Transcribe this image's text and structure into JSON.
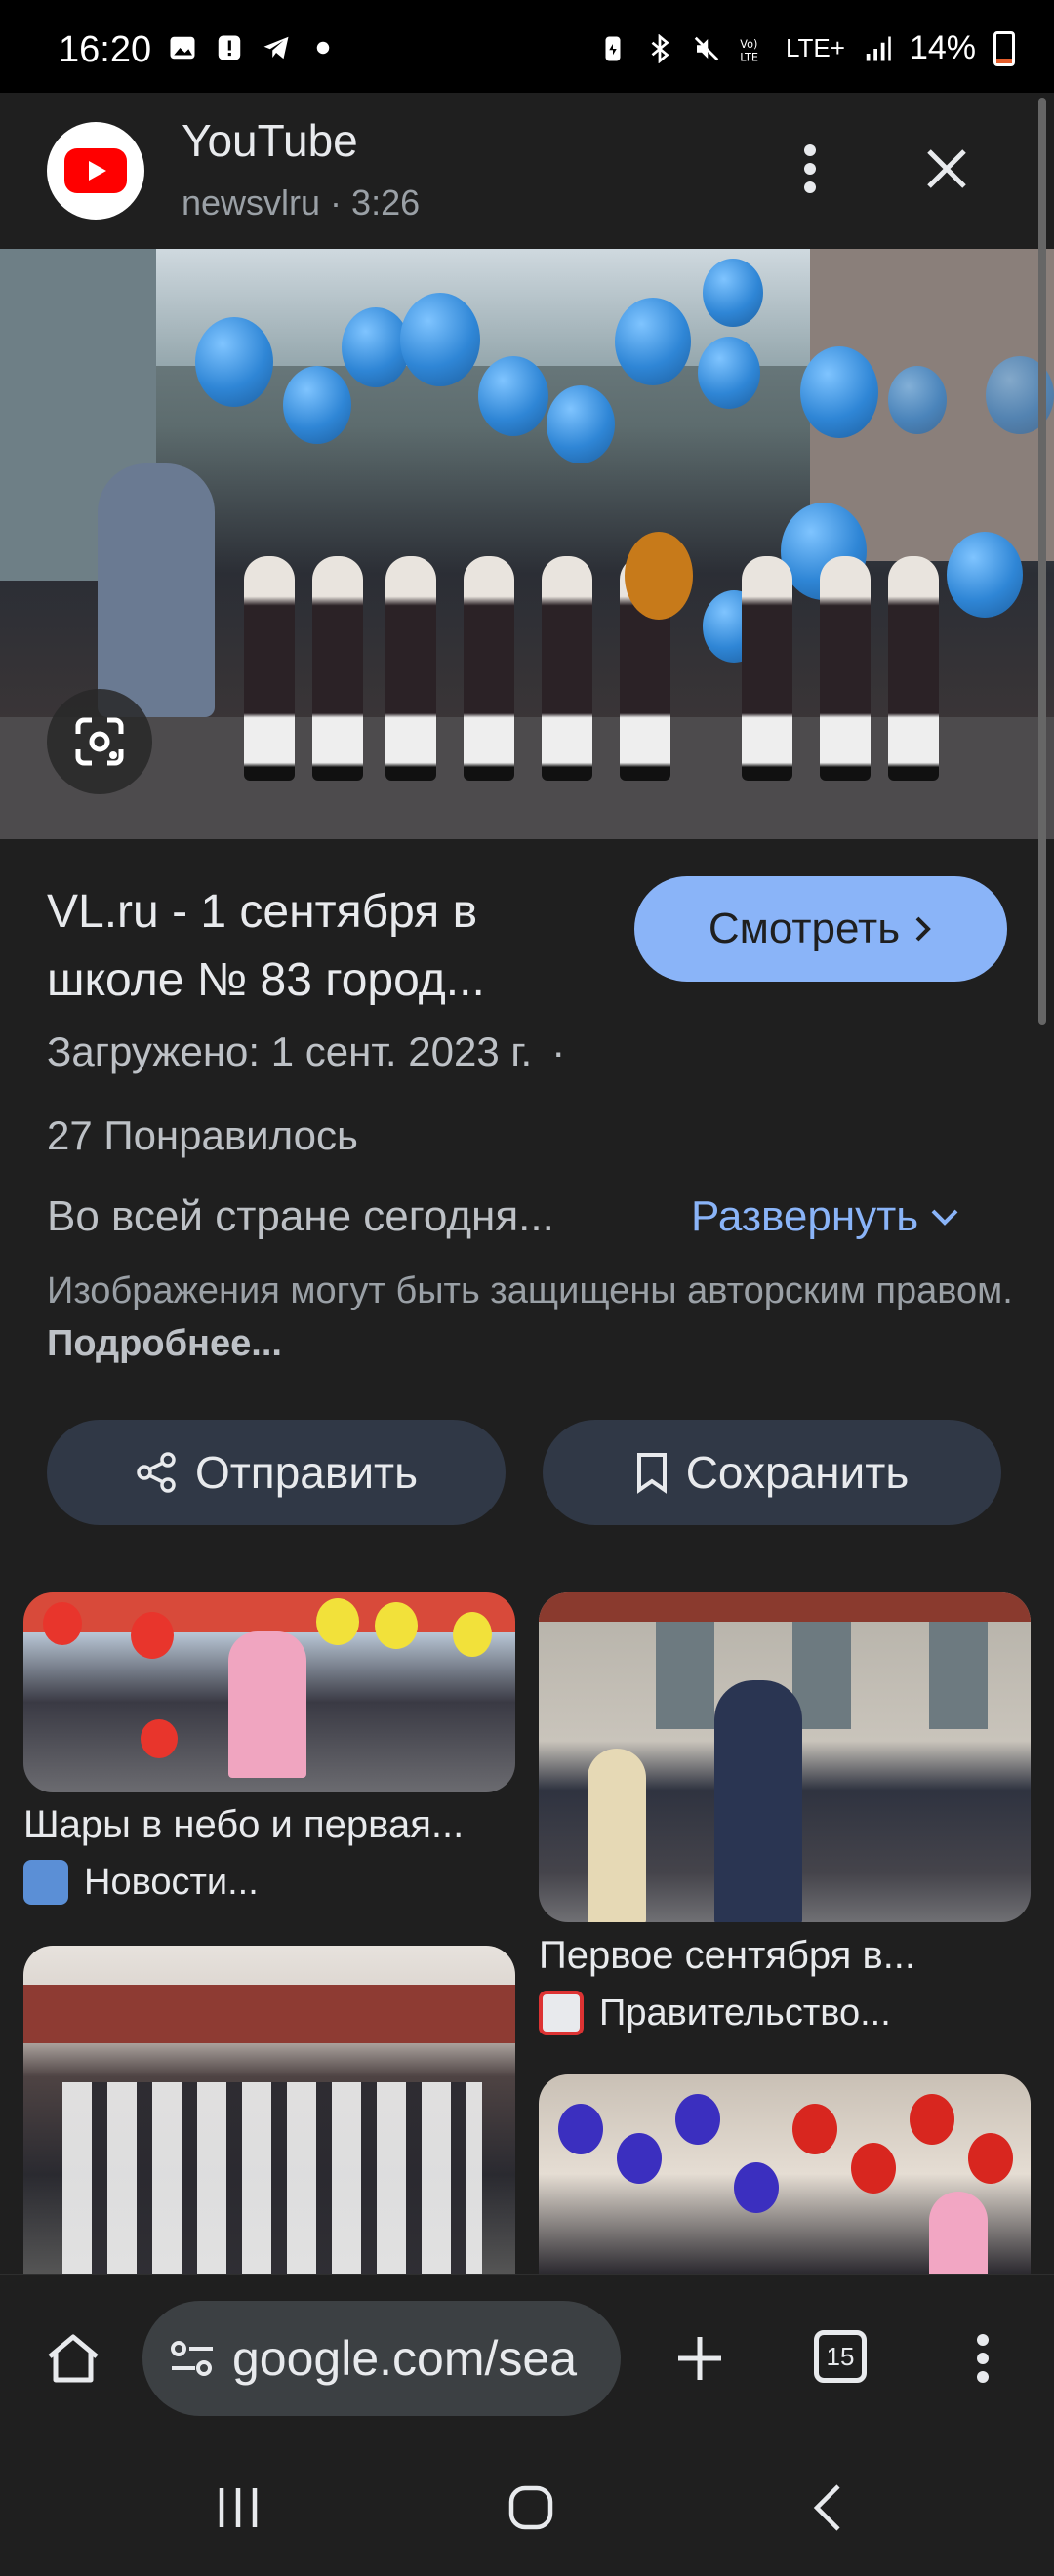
{
  "status_bar": {
    "time": "16:20",
    "battery": "14%",
    "battery_level": 0.14,
    "network": "LTE+"
  },
  "sheet_header": {
    "app_name": "YouTube",
    "subtitle": "newsvlru · 3:26"
  },
  "video": {
    "title": "VL.ru - 1 сентября в школе № 83 город...",
    "watch_label": "Смотреть",
    "uploaded": "Загружено: 1 сент. 2023 г.",
    "uploaded_separator": "·",
    "likes": "27 Понравилось",
    "description": "Во всей стране сегодня...",
    "expand_label": "Развернуть",
    "copyright_text": "Изображения могут быть защищены авторским правом.",
    "copyright_more": "Подробнее..."
  },
  "actions": {
    "share_label": "Отправить",
    "save_label": "Сохранить"
  },
  "results": [
    {
      "title": "Шары в небо и первая...",
      "source": "Новости..."
    },
    {
      "title": "Первое сентября в...",
      "source": "Правительство..."
    }
  ],
  "browser_bar": {
    "url": "google.com/sea",
    "tab_count": "15"
  },
  "colors": {
    "accent": "#8ab4f8",
    "background": "#1f1f1f",
    "pill": "#303846",
    "youtube_red": "#ff0000"
  }
}
